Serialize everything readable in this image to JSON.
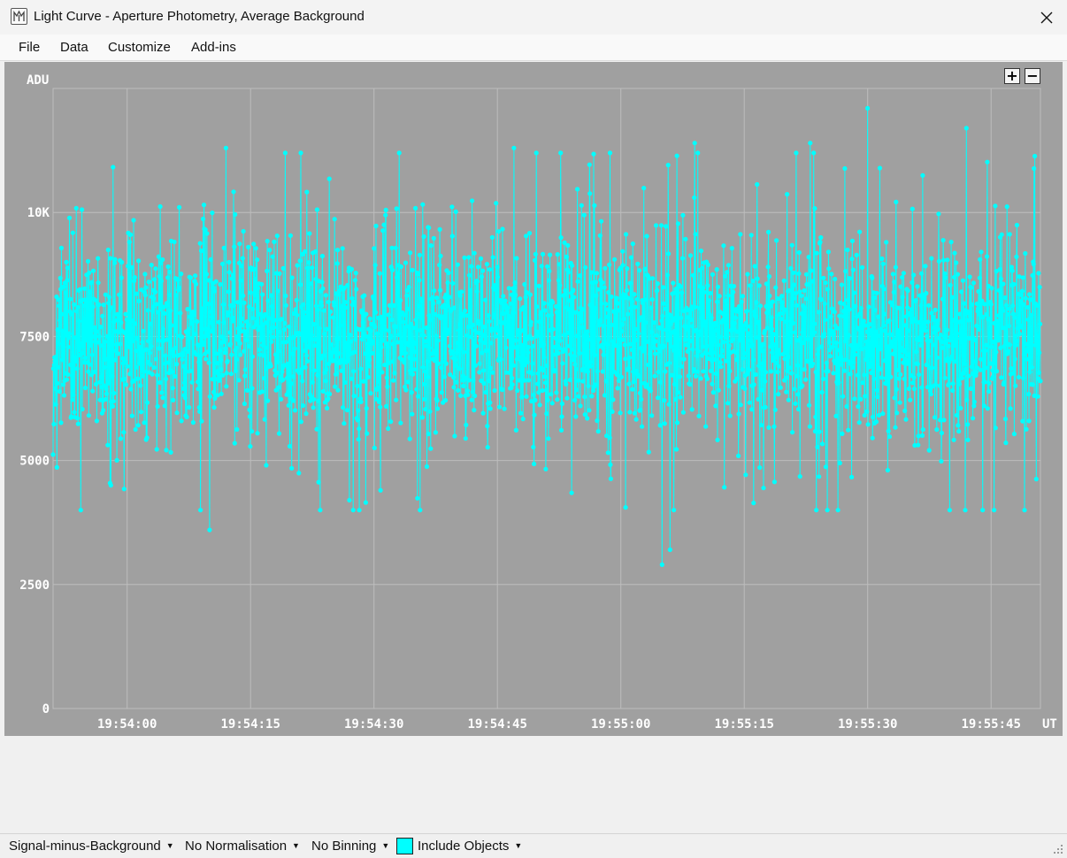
{
  "window": {
    "title": "Light Curve - Aperture Photometry, Average Background",
    "close_glyph": "✕"
  },
  "menu": [
    {
      "label": "File"
    },
    {
      "label": "Data"
    },
    {
      "label": "Customize"
    },
    {
      "label": "Add-ins"
    }
  ],
  "zoom": {
    "plus": "+",
    "minus": "−"
  },
  "colors": {
    "plot_bg": "#a0a0a0",
    "series": "#00ffff",
    "grid": "#bdbdbd",
    "axis_text": "#ffffff"
  },
  "chart_data": {
    "type": "line",
    "ylabel": "ADU",
    "xlabel": "UT",
    "ylim": [
      0,
      12500
    ],
    "yticks": [
      {
        "value": 0,
        "label": "0"
      },
      {
        "value": 2500,
        "label": "2500"
      },
      {
        "value": 5000,
        "label": "5000"
      },
      {
        "value": 7500,
        "label": "7500"
      },
      {
        "value": 10000,
        "label": "10K"
      }
    ],
    "xticks": [
      "19:54:00",
      "19:54:15",
      "19:54:30",
      "19:54:45",
      "19:55:00",
      "19:55:15",
      "19:55:30",
      "19:55:45"
    ],
    "x_range": [
      "19:53:51",
      "19:55:51"
    ],
    "grid": true,
    "markers": true,
    "series": [
      {
        "values_summary": "≈3000 noisy samples around 7500 ADU",
        "mean": 7500,
        "typical_range": [
          5000,
          10000
        ],
        "notable_points": [
          {
            "x": "19:54:10",
            "y": 3600
          },
          {
            "x": "19:53:58",
            "y": 4500
          },
          {
            "x": "19:54:27",
            "y": 4200
          },
          {
            "x": "19:55:05",
            "y": 2900
          },
          {
            "x": "19:55:06",
            "y": 3200
          },
          {
            "x": "19:55:23",
            "y": 3800
          },
          {
            "x": "19:55:42",
            "y": 3650
          },
          {
            "x": "19:55:30",
            "y": 12100
          },
          {
            "x": "19:55:42",
            "y": 11700
          },
          {
            "x": "19:55:23",
            "y": 11400
          },
          {
            "x": "19:54:12",
            "y": 11300
          },
          {
            "x": "19:54:47",
            "y": 11300
          },
          {
            "x": "19:55:09",
            "y": 11400
          }
        ]
      }
    ]
  },
  "status": {
    "signal": "Signal-minus-Background",
    "normalisation": "No Normalisation",
    "binning": "No Binning",
    "include_objects": "Include Objects",
    "swatch_color": "#00ffff"
  }
}
